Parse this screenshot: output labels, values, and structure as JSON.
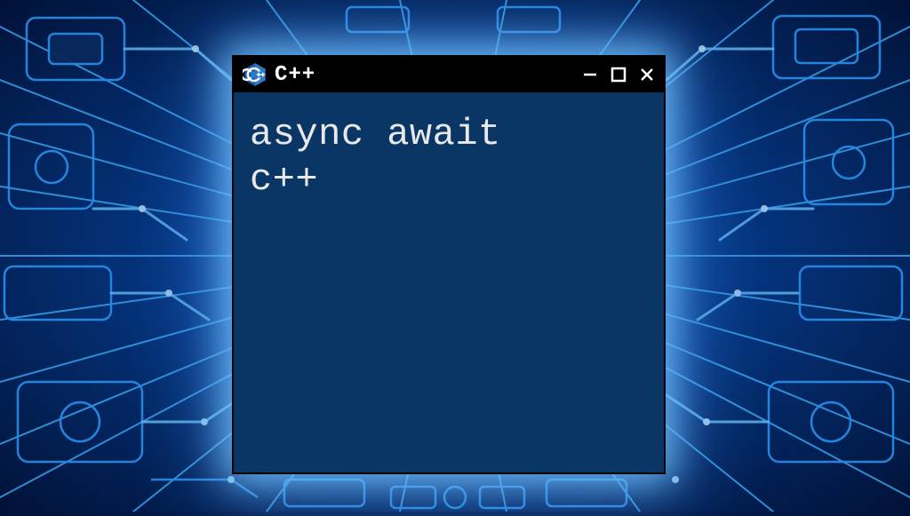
{
  "window": {
    "title": "C++",
    "icon": "cpp-logo-icon",
    "content": "async await\nc++"
  },
  "colors": {
    "window_bg": "#0a3666",
    "titlebar_bg": "#000000",
    "text": "#e8e8e8",
    "accent_glow": "#4fa8ff"
  }
}
